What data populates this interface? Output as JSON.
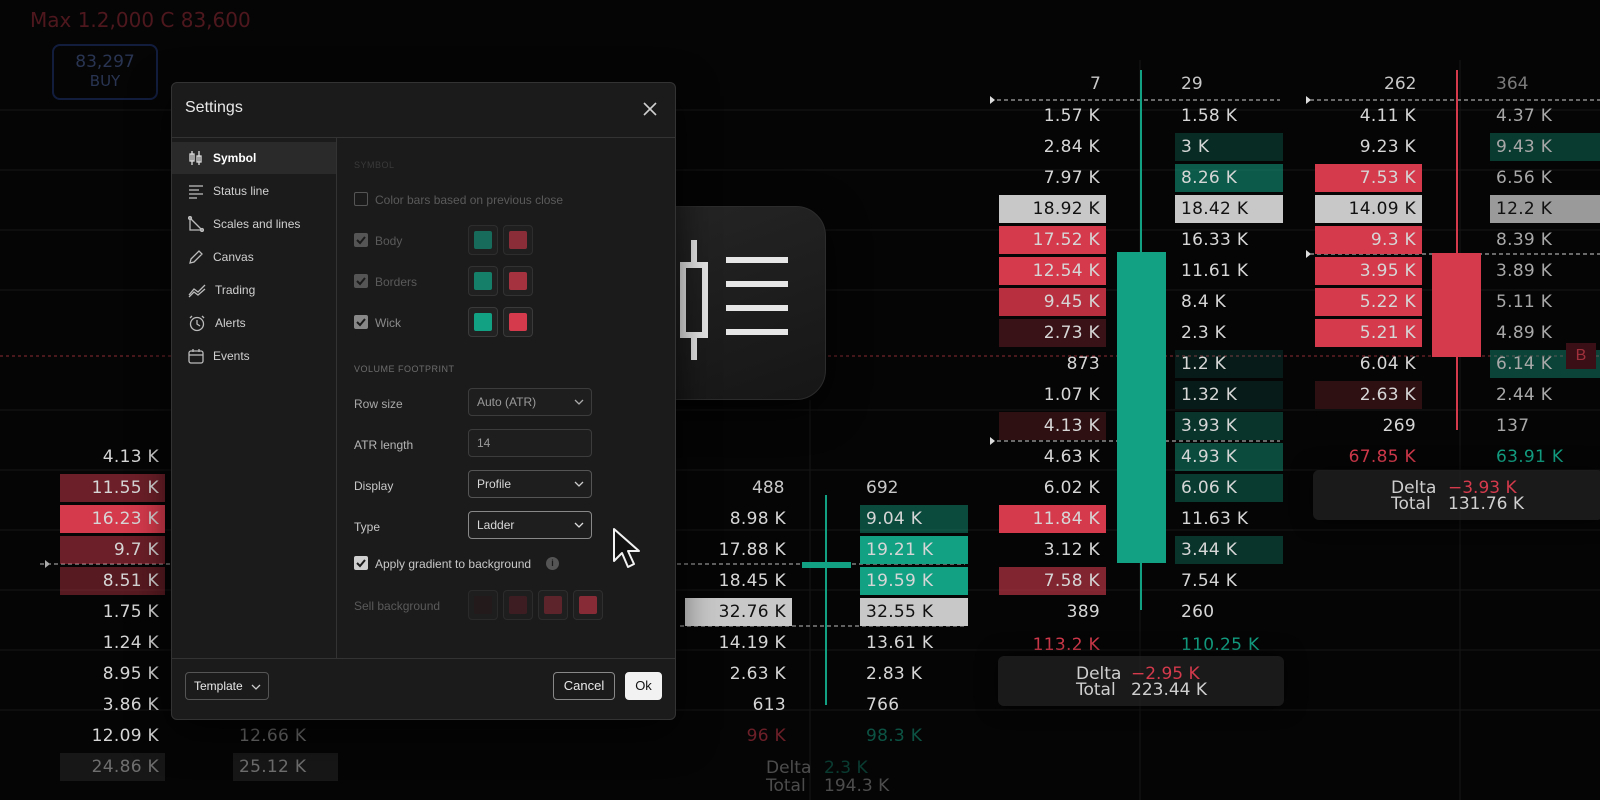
{
  "background": {
    "header_price_text": "Max 1.2,000 C 83,600",
    "buy_badge": {
      "value": "83,297",
      "label": "BUY"
    },
    "col_top_headers": [
      "7",
      "29",
      "262",
      "364"
    ],
    "column_a_rows": [
      [
        "1.57 K",
        "1.58 K"
      ],
      [
        "2.84 K",
        "3 K"
      ],
      [
        "7.97 K",
        "8.26 K"
      ],
      [
        "18.92 K",
        "18.42 K"
      ],
      [
        "17.52 K",
        "16.33 K"
      ],
      [
        "12.54 K",
        "11.61 K"
      ],
      [
        "9.45 K",
        "8.4 K"
      ],
      [
        "2.73 K",
        "2.3 K"
      ],
      [
        "873",
        "1.2 K"
      ],
      [
        "1.07 K",
        "1.32 K"
      ],
      [
        "4.13 K",
        "3.93 K"
      ],
      [
        "4.63 K",
        "4.93 K"
      ],
      [
        "6.02 K",
        "6.06 K"
      ],
      [
        "11.84 K",
        "11.63 K"
      ],
      [
        "3.12 K",
        "3.44 K"
      ],
      [
        "7.58 K",
        "7.54 K"
      ],
      [
        "389",
        "260"
      ],
      [
        "113.2 K",
        "110.25 K"
      ]
    ],
    "column_a_delta": {
      "label": "Delta",
      "value": "−2.95 K",
      "total_label": "Total",
      "total": "223.44 K"
    },
    "column_b_rows": [
      [
        "4.11 K",
        "4.37 K"
      ],
      [
        "9.23 K",
        "9.43 K"
      ],
      [
        "7.53 K",
        "6.56 K"
      ],
      [
        "14.09 K",
        "12.2 K"
      ],
      [
        "9.3 K",
        "8.39 K"
      ],
      [
        "3.95 K",
        "3.89 K"
      ],
      [
        "5.22 K",
        "5.11 K"
      ],
      [
        "5.21 K",
        "4.89 K"
      ],
      [
        "6.04 K",
        "6.14 K"
      ],
      [
        "2.63 K",
        "2.44 K"
      ],
      [
        "269",
        "137"
      ],
      [
        "67.85 K",
        "63.91 K"
      ]
    ],
    "column_b_delta": {
      "label": "Delta",
      "value": "−3.93 K",
      "total_label": "Total",
      "total": "131.76 K"
    },
    "column_c_headers": [
      "488",
      "692"
    ],
    "column_c_rows": [
      [
        "8.98 K",
        "9.04 K"
      ],
      [
        "17.88 K",
        "19.21 K"
      ],
      [
        "18.45 K",
        "19.59 K"
      ],
      [
        "32.76 K",
        "32.55 K"
      ],
      [
        "14.19 K",
        "13.61 K"
      ],
      [
        "2.63 K",
        "2.83 K"
      ],
      [
        "613",
        "766"
      ],
      [
        "96 K",
        "98.3 K"
      ]
    ],
    "column_c_delta": {
      "label": "Delta",
      "value": "2.3 K",
      "total_label": "Total",
      "total": "194.3 K"
    },
    "left_rows": [
      "4.13 K",
      "11.55 K",
      "16.23 K",
      "9.7 K",
      "8.51 K",
      "1.75 K",
      "1.24 K",
      "8.95 K",
      "3.86 K",
      "12.09 K",
      "24.86 K"
    ],
    "left_rows_b": [
      "12.66 K",
      "25.12 K"
    ],
    "right_edge_badge": "B"
  },
  "dialog": {
    "title": "Settings",
    "sidebar": [
      {
        "label": "Symbol",
        "icon": "candlestick-icon",
        "active": true
      },
      {
        "label": "Status line",
        "icon": "status-line-icon"
      },
      {
        "label": "Scales and lines",
        "icon": "scales-icon"
      },
      {
        "label": "Canvas",
        "icon": "pencil-icon"
      },
      {
        "label": "Trading",
        "icon": "trading-icon"
      },
      {
        "label": "Alerts",
        "icon": "alarm-clock-icon"
      },
      {
        "label": "Events",
        "icon": "calendar-icon"
      }
    ],
    "content": {
      "faded_header": "SYMBOL",
      "color_bars_label": "Color bars based on previous close",
      "body_label": "Body",
      "borders_label": "Borders",
      "wick_label": "Wick",
      "section_volume": "VOLUME FOOTPRINT",
      "row_size_label": "Row size",
      "row_size_value": "Auto (ATR)",
      "atr_length_label": "ATR length",
      "atr_length_value": "14",
      "display_label": "Display",
      "display_value": "Profile",
      "type_label": "Type",
      "type_value": "Ladder",
      "gradient_label": "Apply gradient to background",
      "sell_bg_label": "Sell background"
    },
    "footer": {
      "template_label": "Template",
      "cancel_label": "Cancel",
      "ok_label": "Ok"
    }
  },
  "colors": {
    "buy_green": "#13a184",
    "sell_red": "#d43a4c",
    "panel_bg": "#1b1b1b"
  }
}
